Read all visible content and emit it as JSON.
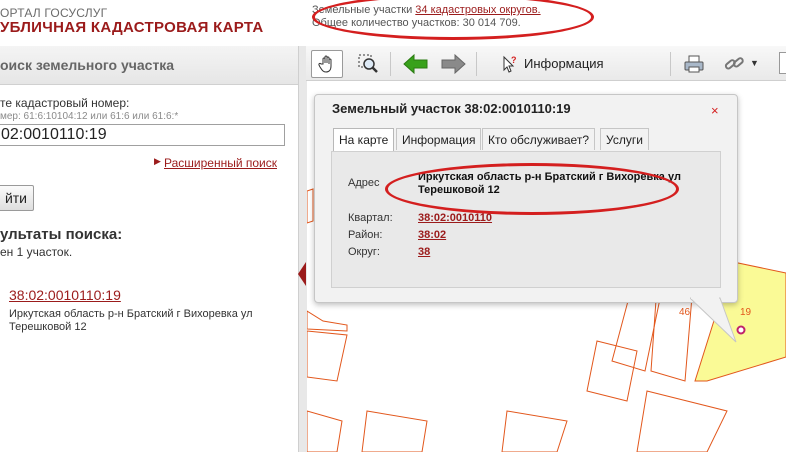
{
  "header": {
    "portal": "ОРТАЛ ГОСУСЛУГ",
    "title": "УБЛИЧНАЯ КАДАСТРОВАЯ КАРТА",
    "stats_line1_prefix": "Земельные участки",
    "stats_line1_link": "34 кадастровых округов.",
    "stats_line2": "Общее количество участков: 30 014 709."
  },
  "search": {
    "title": "оиск земельного участка",
    "label": "те кадастровый номер:",
    "hint": "мер: 61:6:10104:12 или 61:6 или 61:6:*",
    "value": "02:0010110:19",
    "advanced_link": "Расширенный поиск",
    "find_button": "йти",
    "results_title": "ультаты поиска:",
    "results_count": "ен 1 участок.",
    "result_link": "38:02:0010110:19",
    "result_address": "Иркутская область р-н Братский г Вихоревка ул Терешковой 12"
  },
  "toolbar": {
    "info_label": "Информация",
    "icons": [
      "hand-icon",
      "zoom-select-icon",
      "back-arrow-icon",
      "forward-arrow-icon",
      "info-cursor-icon",
      "print-icon",
      "link-icon"
    ]
  },
  "popup": {
    "title": "Земельный участок 38:02:0010110:19",
    "close": "×",
    "tabs": [
      "На карте",
      "Информация",
      "Кто обслуживает?",
      "Услуги"
    ],
    "address_label": "Адрес",
    "address_value": "Иркутская область р-н Братский г Вихоревка ул Терешковой 12",
    "quarter_label": "Квартал:",
    "quarter_value": "38:02:0010110",
    "district_label": "Район:",
    "district_value": "38:02",
    "okrug_label": "Округ:",
    "okrug_value": "38"
  },
  "map": {
    "parcel_labels": [
      "46",
      "19"
    ],
    "zoom_in": "+",
    "zoom_out": "−",
    "colors": {
      "parcel_line": "#e2571c",
      "selected_fill": "#fafa96",
      "accent": "#9b1b1b",
      "highlight": "#d41f1f"
    }
  }
}
